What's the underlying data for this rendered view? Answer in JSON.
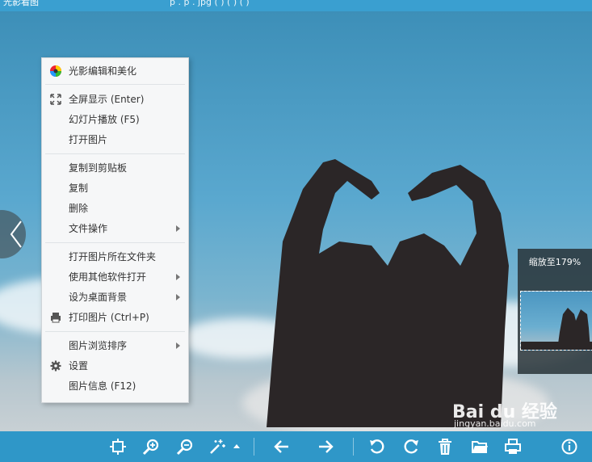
{
  "window": {
    "title": "光影看图",
    "file_info": "p . p . jpg ( ) ( ) ( )"
  },
  "menu": {
    "items": [
      {
        "label": "光影编辑和美化",
        "icon": "color-wheel-icon"
      },
      {
        "label": "全屏显示 (Enter)",
        "icon": "fullscreen-icon"
      },
      {
        "label": "幻灯片播放 (F5)"
      },
      {
        "label": "打开图片"
      },
      {
        "label": "复制到剪贴板"
      },
      {
        "label": "复制"
      },
      {
        "label": "删除"
      },
      {
        "label": "文件操作",
        "submenu": true
      },
      {
        "label": "打开图片所在文件夹"
      },
      {
        "label": "使用其他软件打开",
        "submenu": true
      },
      {
        "label": "设为桌面背景",
        "submenu": true
      },
      {
        "label": "打印图片 (Ctrl+P)",
        "icon": "printer-icon"
      },
      {
        "label": "图片浏览排序",
        "submenu": true
      },
      {
        "label": "设置",
        "icon": "gear-icon"
      },
      {
        "label": "图片信息 (F12)"
      }
    ]
  },
  "zoom_panel": {
    "label": "缩放至179%"
  },
  "watermark": {
    "logo": "Bai du 经验",
    "url": "jingyan.baidu.com"
  },
  "toolbar": {
    "buttons": [
      "fit-window-icon",
      "zoom-in-icon",
      "zoom-out-icon",
      "magic-wand-icon",
      "previous-icon",
      "next-icon",
      "rotate-left-icon",
      "rotate-right-icon",
      "delete-icon",
      "open-folder-icon",
      "print-icon",
      "info-icon"
    ]
  }
}
